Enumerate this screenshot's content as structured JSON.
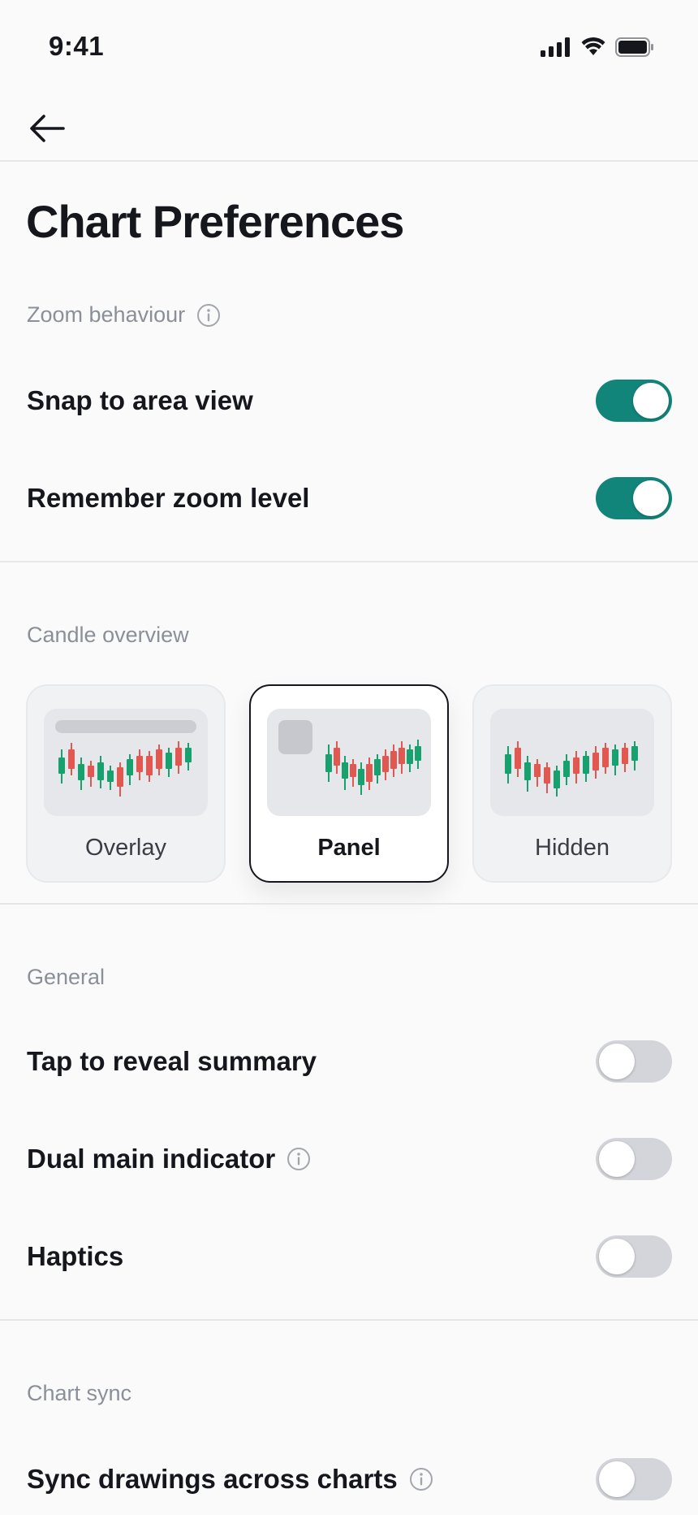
{
  "status_bar": {
    "time": "9:41"
  },
  "nav": {
    "back_icon": "arrow-left-icon"
  },
  "page": {
    "title": "Chart Preferences"
  },
  "colors": {
    "accent": "#12857a",
    "toggle_off": "#d3d5da",
    "candle_up": "#18a06f",
    "candle_down": "#e0584f"
  },
  "zoom": {
    "label": "Zoom behaviour",
    "rows": [
      {
        "label": "Snap to area view",
        "on": true
      },
      {
        "label": "Remember zoom level",
        "on": true
      }
    ]
  },
  "candle": {
    "label": "Candle overview",
    "options": [
      {
        "label": "Overlay",
        "selected": false
      },
      {
        "label": "Panel",
        "selected": true
      },
      {
        "label": "Hidden",
        "selected": false
      }
    ]
  },
  "general": {
    "label": "General",
    "rows": [
      {
        "label": "Tap to reveal summary",
        "on": false
      },
      {
        "label": "Dual main indicator",
        "on": false
      },
      {
        "label": "Haptics",
        "on": false
      }
    ]
  },
  "sync": {
    "label": "Chart sync",
    "rows": [
      {
        "label": "Sync drawings across charts",
        "on": false
      }
    ]
  }
}
